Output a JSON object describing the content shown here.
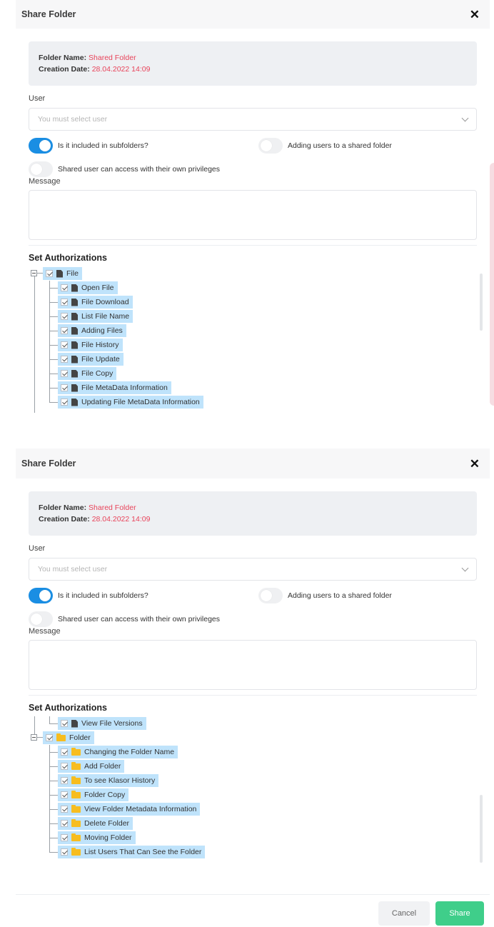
{
  "dialog": {
    "title": "Share Folder",
    "close_icon": "close-icon",
    "folder_name_label": "Folder Name:",
    "folder_name_value": "Shared Folder",
    "creation_date_label": "Creation Date:",
    "creation_date_value": "28.04.2022 14:09",
    "user_label": "User",
    "user_placeholder": "You must select user",
    "toggle_subfolders_label": "Is it included in subfolders?",
    "toggle_subfolders_on": true,
    "toggle_adding_users_label": "Adding users to a shared folder",
    "toggle_adding_users_on": false,
    "toggle_privileges_label": "Shared user can access with their own privileges",
    "toggle_privileges_on": false,
    "message_label": "Message",
    "authorizations_title": "Set Authorizations"
  },
  "tree_top": {
    "root": "File",
    "items": [
      "Open File",
      "File Download",
      "List File Name",
      "Adding Files",
      "File History",
      "File Update",
      "File Copy",
      "File MetaData Information",
      "Updating File MetaData Information"
    ]
  },
  "tree_bottom": {
    "prev_item": "View File Versions",
    "root": "Folder",
    "items": [
      "Changing the Folder Name",
      "Add Folder",
      "To see Klasor History",
      "Folder Copy",
      "View Folder Metadata Information",
      "Delete Folder",
      "Moving Folder",
      "List Users That Can See the Folder"
    ]
  },
  "footer": {
    "cancel_label": "Cancel",
    "share_label": "Share"
  },
  "colors": {
    "accent": "#1a8ee3",
    "value_red": "#e8435a",
    "highlight": "#bfe3fb",
    "share_green": "#3fce8a",
    "folder_yellow": "#f7bd1f"
  }
}
